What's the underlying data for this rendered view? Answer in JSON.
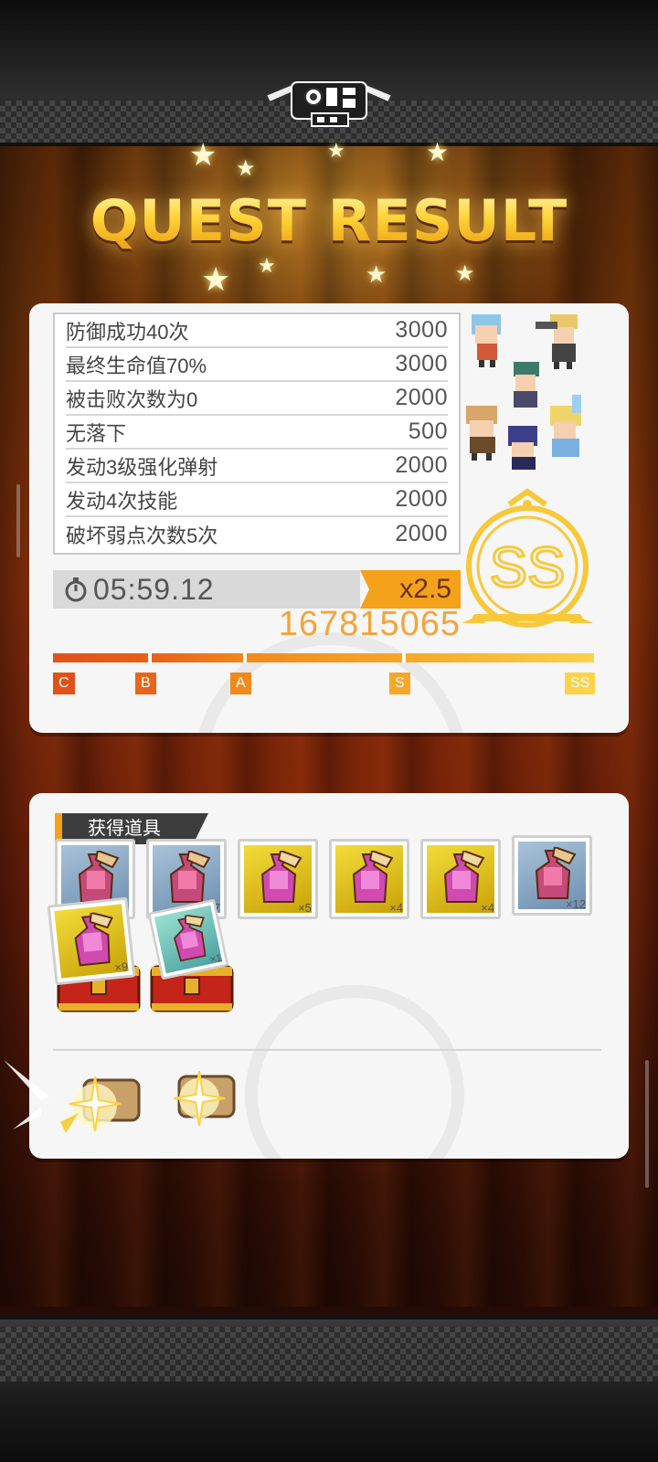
{
  "title": "QUEST RESULT",
  "conditions": [
    {
      "label": "防御成功40次",
      "value": "3000"
    },
    {
      "label": "最终生命值70%",
      "value": "3000"
    },
    {
      "label": "被击败次数为0",
      "value": "2000"
    },
    {
      "label": "无落下",
      "value": "500"
    },
    {
      "label": "发动3级强化弹射",
      "value": "2000"
    },
    {
      "label": "发动4次技能",
      "value": "2000"
    },
    {
      "label": "破坏弱点次数5次",
      "value": "2000"
    }
  ],
  "time": "05:59.12",
  "multiplier": "x2.5",
  "score": "167815065",
  "rank": "SS",
  "rank_gauge": {
    "labels": [
      "C",
      "B",
      "A",
      "S",
      "SS"
    ],
    "colors": [
      "#e0521a",
      "#e8651b",
      "#f08a1c",
      "#f6a72a",
      "#fbd24a"
    ]
  },
  "items_header": "获得道具",
  "items": [
    {
      "bg": "blue",
      "qty": "×7"
    },
    {
      "bg": "blue",
      "qty": "×7"
    },
    {
      "bg": "gold",
      "qty": "×5"
    },
    {
      "bg": "gold",
      "qty": "×4"
    },
    {
      "bg": "gold",
      "qty": "×4"
    },
    {
      "bg": "blue",
      "qty": "×12"
    }
  ],
  "chest_items": [
    {
      "bg": "gold",
      "qty": "×9"
    },
    {
      "bg": "blue",
      "qty": "×1"
    }
  ],
  "colors": {
    "accent": "#f4a11c",
    "score": "#f3a43c",
    "title": "#ffd64a"
  }
}
